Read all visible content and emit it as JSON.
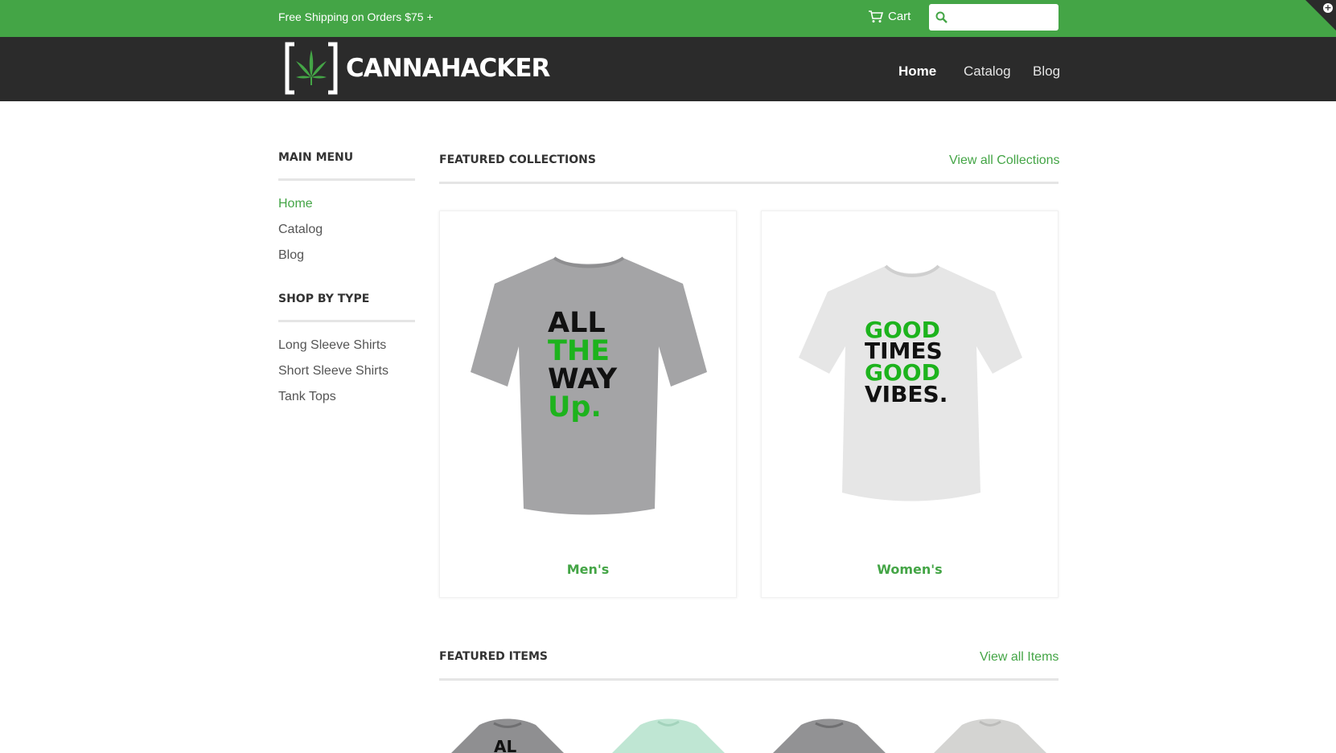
{
  "topbar": {
    "shipping_text": "Free Shipping on Orders $75 +",
    "cart_label": "Cart",
    "search_placeholder": "",
    "accent_color": "#44a546"
  },
  "header": {
    "logo_text": "CANNAHACKER",
    "nav": [
      "Home",
      "Catalog",
      "Blog"
    ],
    "active_nav": "Home"
  },
  "sidebar": {
    "main_menu_title": "MAIN MENU",
    "main_menu": [
      "Home",
      "Catalog",
      "Blog"
    ],
    "shop_by_type_title": "SHOP BY TYPE",
    "shop_by_type": [
      "Long Sleeve Shirts",
      "Short Sleeve Shirts",
      "Tank Tops"
    ]
  },
  "featured_collections": {
    "title": "FEATURED COLLECTIONS",
    "view_all": "View all Collections",
    "cards": [
      {
        "label": "Men's",
        "shirt_text": [
          "ALL",
          "THE",
          "WAY",
          "Up."
        ]
      },
      {
        "label": "Women's",
        "shirt_text": [
          "GOOD",
          "TIMES",
          "GOOD",
          "VIBES."
        ]
      }
    ]
  },
  "featured_items": {
    "title": "FEATURED ITEMS",
    "view_all": "View all Items",
    "shirt_top_text": "AL"
  }
}
